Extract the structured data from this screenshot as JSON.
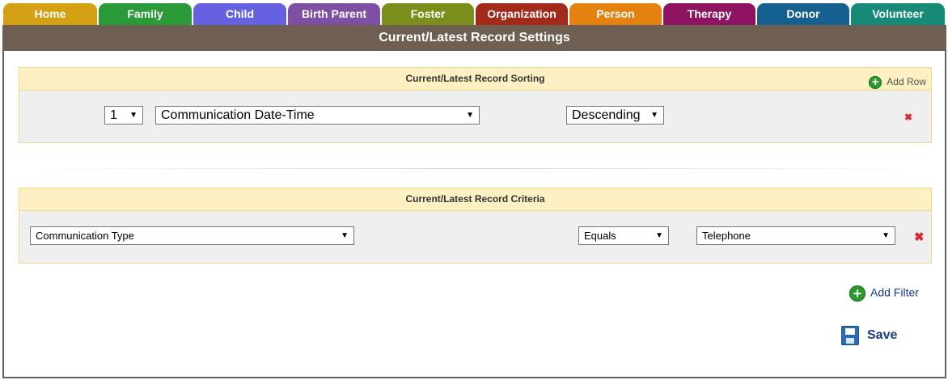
{
  "tabs": [
    {
      "label": "Home",
      "color": "#d4a014"
    },
    {
      "label": "Family",
      "color": "#2b9a39"
    },
    {
      "label": "Child",
      "color": "#6661e0"
    },
    {
      "label": "Birth Parent",
      "color": "#7f4fa4"
    },
    {
      "label": "Foster",
      "color": "#7a8e1c"
    },
    {
      "label": "Organization",
      "color": "#a3291a"
    },
    {
      "label": "Person",
      "color": "#e3820f"
    },
    {
      "label": "Therapy",
      "color": "#8e1461"
    },
    {
      "label": "Donor",
      "color": "#15608f"
    },
    {
      "label": "Volunteer",
      "color": "#168977"
    }
  ],
  "header": {
    "title": "Current/Latest Record Settings"
  },
  "sorting": {
    "title": "Current/Latest Record Sorting",
    "add_row_label": "Add Row",
    "row": {
      "order": "1",
      "field": "Communication Date-Time",
      "direction": "Descending"
    }
  },
  "criteria": {
    "title": "Current/Latest Record Criteria",
    "row": {
      "field": "Communication Type",
      "operator": "Equals",
      "value": "Telephone"
    }
  },
  "actions": {
    "add_filter_label": "Add Filter",
    "save_label": "Save"
  },
  "icons": {
    "remove": "x-icon",
    "add": "plus-circle-icon",
    "save": "floppy-disk-icon"
  }
}
